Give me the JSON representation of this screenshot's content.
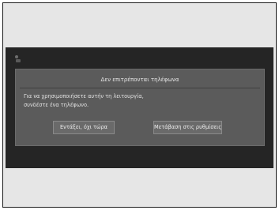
{
  "dialog": {
    "title": "Δεν επιτρέπονται τηλέφωνα",
    "message": "Για να χρησιμοποιήσετε αυτήν τη λειτουργία,\nσυνδέστε ένα τηλέφωνο.",
    "buttons": {
      "left_label": "Εντάξει, όχι τώρα",
      "right_label": "Μετάβαση στις ρυθμίσεις"
    }
  },
  "icons": {
    "corner": "notification-icon"
  },
  "colors": {
    "frame_background": "#e6e6e6",
    "screen_background": "#252525",
    "dialog_background": "#5b5b5b",
    "button_background": "#6a6a6a"
  }
}
